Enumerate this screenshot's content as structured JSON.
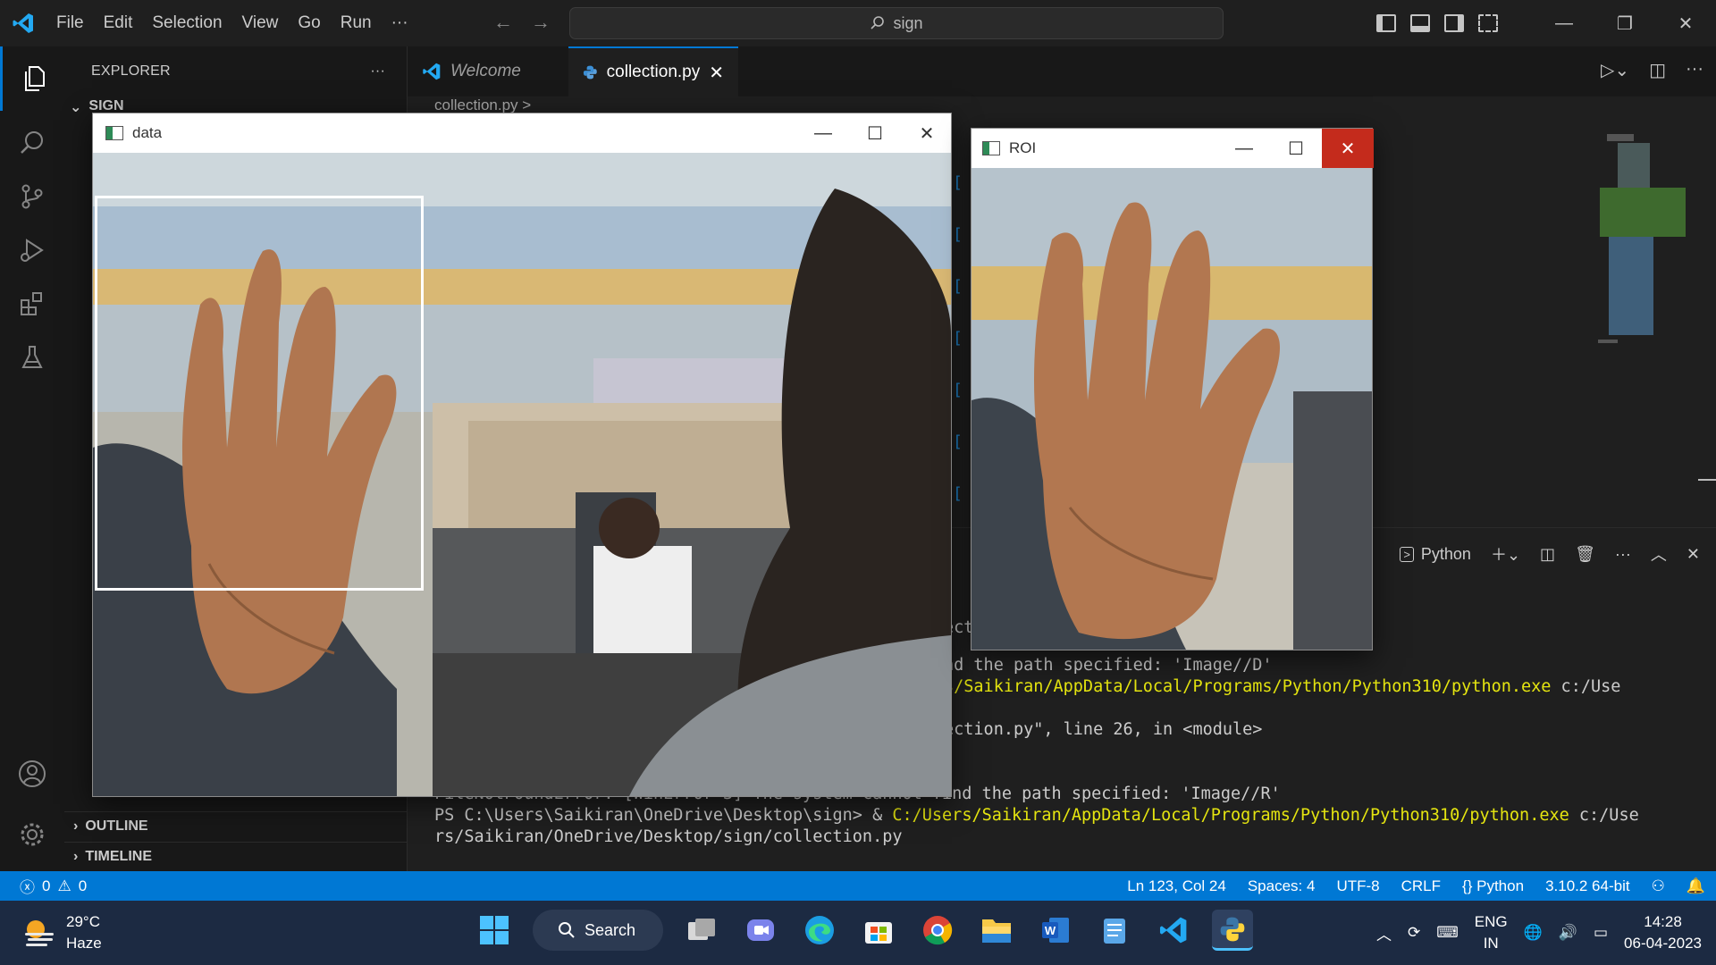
{
  "titlebar": {
    "menu": [
      "File",
      "Edit",
      "Selection",
      "View",
      "Go",
      "Run",
      "···"
    ],
    "search_text": "sign"
  },
  "sidebar": {
    "title": "EXPLORER",
    "more": "···",
    "folder": "SIGN",
    "outline": "OUTLINE",
    "timeline": "TIMELINE"
  },
  "tabs": {
    "welcome": "Welcome",
    "active": "collection.py"
  },
  "breadcrumb": "collection.py >",
  "panel": {
    "terminal_name": "Python"
  },
  "terminal": {
    "l1": "nd the path specified: 'Image//D'",
    "l2": "s/Saikiran/AppData/Local/Programs/Python/Python310/python.exe",
    "l2b": " c:/Use",
    "l3": "ection.py\", line 26, in <module>",
    "l4": "FileNotFoundError: [WinError 3] The system cannot find the path specified: 'Image//R'",
    "l5a": "PS C:\\Users\\Saikiran\\OneDrive\\Desktop\\sign> & ",
    "l5b": "C:/Users/Saikiran/AppData/Local/Programs/Python/Python310/python.exe",
    "l5c": " c:/Use",
    "l6": "rs/Saikiran/OneDrive/Desktop/sign/collection.py"
  },
  "statusbar": {
    "errors": "0",
    "warnings": "0",
    "position": "Ln 123, Col 24",
    "spaces": "Spaces: 4",
    "encoding": "UTF-8",
    "eol": "CRLF",
    "language": "Python",
    "interpreter": "3.10.2 64-bit"
  },
  "cv_windows": {
    "data_title": "data",
    "roi_title": "ROI"
  },
  "taskbar": {
    "temp": "29°C",
    "condition": "Haze",
    "search": "Search",
    "lang1": "ENG",
    "lang2": "IN",
    "time": "14:28",
    "date": "06-04-2023"
  },
  "colors": {
    "accent": "#0078d4",
    "terminal_yellow": "#e5e510",
    "close_red": "#c42b1c"
  }
}
